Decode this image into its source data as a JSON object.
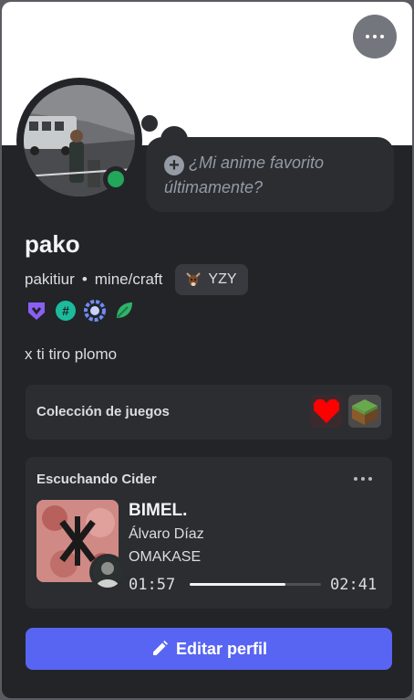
{
  "profile": {
    "display_name": "pako",
    "username": "pakitiur",
    "pronouns": "mine/craft",
    "server_tag": "YZY",
    "bio": "x ti tiro plomo",
    "status": "online",
    "note_placeholder": "¿Mi anime favorito últimamente?"
  },
  "badges": [
    "hypesquad-balance-icon",
    "hashtag-quest-icon",
    "laurel-badge-icon",
    "leaf-badge-icon"
  ],
  "games": {
    "title": "Colección de juegos",
    "items": [
      "undertale-heart-icon",
      "minecraft-grass-block-icon"
    ]
  },
  "activity": {
    "title": "Escuchando Cider",
    "song": "BIMEL.",
    "artist": "Álvaro Díaz",
    "album": "OMAKASE",
    "elapsed": "01:57",
    "duration": "02:41",
    "progress": 0.73
  },
  "actions": {
    "edit_profile": "Editar perfil"
  },
  "colors": {
    "accent": "#5865f2",
    "online": "#23a55a",
    "card": "#232428",
    "section": "#2b2d31"
  }
}
